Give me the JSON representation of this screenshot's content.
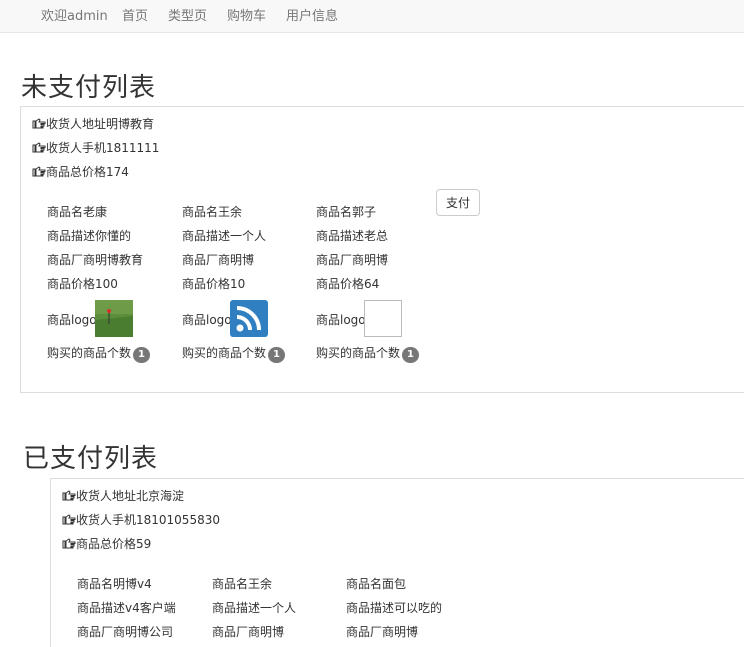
{
  "nav": {
    "welcome": "欢迎admin",
    "items": [
      "首页",
      "类型页",
      "购物车",
      "用户信息"
    ]
  },
  "unpaid": {
    "title": "未支付列表",
    "address": "收货人地址明博教育",
    "phone": "收货人手机1811111",
    "total": "商品总价格174",
    "pay_label": "支付",
    "products": [
      {
        "name": "商品名老康",
        "desc": "商品描述你懂的",
        "maker": "商品厂商明博教育",
        "price": "商品价格100",
        "logo_label": "商品logo",
        "logo_icon": "grass-photo-icon",
        "count_label": "购买的商品个数",
        "count": "1"
      },
      {
        "name": "商品名王余",
        "desc": "商品描述一个人",
        "maker": "商品厂商明博",
        "price": "商品价格10",
        "logo_label": "商品logo",
        "logo_icon": "rss-feed-icon",
        "count_label": "购买的商品个数",
        "count": "1"
      },
      {
        "name": "商品名郭子",
        "desc": "商品描述老总",
        "maker": "商品厂商明博",
        "price": "商品价格64",
        "logo_label": "商品logo",
        "logo_icon": "broken-image-icon",
        "count_label": "购买的商品个数",
        "count": "1"
      }
    ]
  },
  "paid": {
    "title": "已支付列表",
    "address": "收货人地址北京海淀",
    "phone": "收货人手机18101055830",
    "total": "商品总价格59",
    "products": [
      {
        "name": "商品名明博v4",
        "desc": "商品描述v4客户端",
        "maker": "商品厂商明博公司"
      },
      {
        "name": "商品名王余",
        "desc": "商品描述一个人",
        "maker": "商品厂商明博"
      },
      {
        "name": "商品名面包",
        "desc": "商品描述可以吃的",
        "maker": "商品厂商明博"
      }
    ]
  },
  "colors": {
    "badge": "#777777",
    "rss": "#2f7fc1",
    "grass": "#4f8a36"
  }
}
